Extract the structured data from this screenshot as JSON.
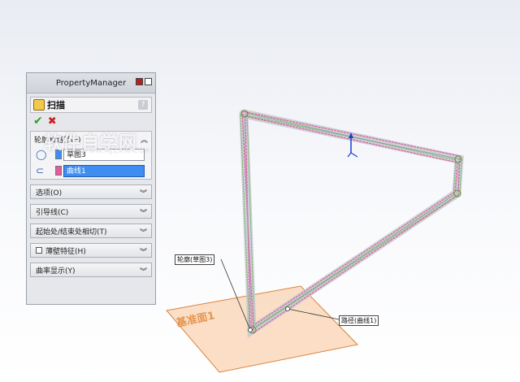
{
  "property_manager": {
    "title": "PropertyManager",
    "feature": {
      "title": "扫描",
      "help": "?"
    },
    "confirm": {
      "ok": "✔",
      "cancel": "✖"
    },
    "profile_path": {
      "header": "轮廓和路径(P)",
      "profile_value": "草图3",
      "path_value": "曲线1"
    },
    "sections": [
      {
        "label": "选项(O)"
      },
      {
        "label": "引导线(C)"
      },
      {
        "label": "起始处/结束处相切(T)"
      },
      {
        "label": "薄壁特征(H)",
        "checkbox": true
      },
      {
        "label": "曲率显示(Y)"
      }
    ]
  },
  "viewport": {
    "callout_profile": "轮廓(草图3)",
    "callout_path": "路径(曲线1)",
    "plane_label": "基准面1"
  },
  "watermark": {
    "title": "软件自学网",
    "url": "WWW.RJZXW.COM"
  },
  "colors": {
    "selection_blue": "#3d8ef0",
    "plane_orange": "#f6a35c",
    "profile_pink": "#e25ca0",
    "path_green": "#6ab04c"
  }
}
